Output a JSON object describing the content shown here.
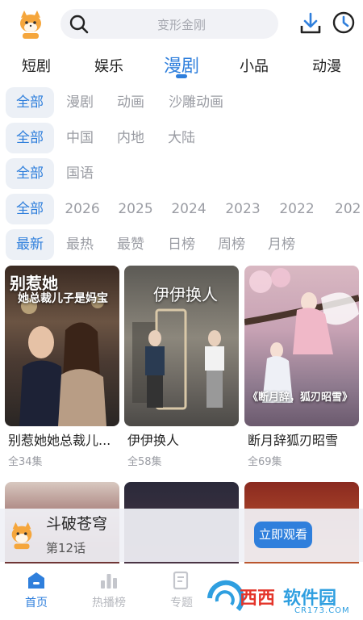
{
  "search": {
    "placeholder": "变形金刚"
  },
  "tabs": [
    {
      "label": "短剧"
    },
    {
      "label": "娱乐"
    },
    {
      "label": "漫剧"
    },
    {
      "label": "小品"
    },
    {
      "label": "动漫"
    }
  ],
  "active_tab": "漫剧",
  "filters": {
    "type": [
      "全部",
      "漫剧",
      "动画",
      "沙雕动画"
    ],
    "region": [
      "全部",
      "中国",
      "内地",
      "大陆"
    ],
    "language": [
      "全部",
      "国语"
    ],
    "year": [
      "全部",
      "2026",
      "2025",
      "2024",
      "2023",
      "2022",
      "202"
    ],
    "sort": [
      "最新",
      "最热",
      "最赞",
      "日榜",
      "周榜",
      "月榜"
    ]
  },
  "cards": [
    {
      "title": "别惹她她总裁儿...",
      "episodes": "全34集",
      "poster_text": [
        "别惹她",
        "她总裁儿子是妈宝"
      ]
    },
    {
      "title": "伊伊换人",
      "episodes": "全58集",
      "poster_text": [
        "伊伊换人"
      ]
    },
    {
      "title": "断月辞狐刃昭雪",
      "episodes": "全69集",
      "poster_text": [
        "《断月辞，狐刃昭雪》"
      ]
    }
  ],
  "player": {
    "title": "斗破苍穹",
    "episode": "第12话",
    "button": "立即观看"
  },
  "bottom_nav": [
    {
      "label": "首页"
    },
    {
      "label": "热播榜"
    },
    {
      "label": "专题"
    }
  ],
  "watermark": {
    "brand": "西西",
    "site": "软件园",
    "url": "CR173.COM"
  },
  "colors": {
    "accent": "#2f7fdc",
    "muted": "#9a9ca3",
    "chip_bg": "#ecf0f6"
  }
}
